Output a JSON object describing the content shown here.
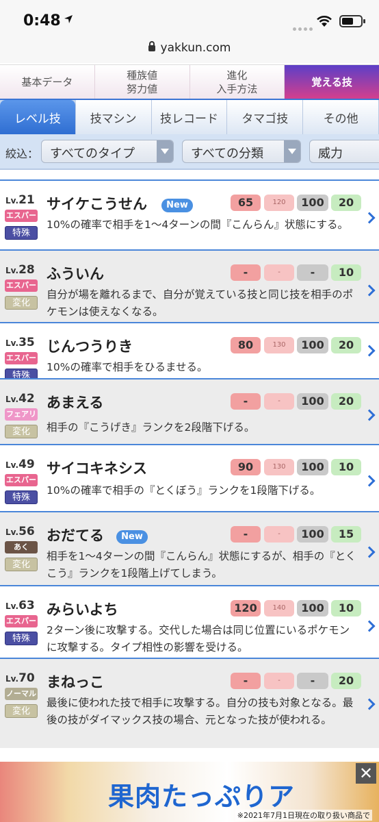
{
  "status_bar": {
    "time": "0:48",
    "domain": "yakkun.com"
  },
  "top_tabs": [
    "基本データ",
    "種族値\n努力値",
    "進化\n入手方法",
    "覚える技"
  ],
  "sub_tabs": [
    "レベル技",
    "技マシン",
    "技レコード",
    "タマゴ技",
    "その他"
  ],
  "filter": {
    "label": "絞込：",
    "type_select": "すべてのタイプ",
    "class_select": "すべての分類",
    "sort_select": "威力"
  },
  "moves": [
    {
      "level_prefix": "Lv.",
      "level": "21",
      "type": "エスパー",
      "type_color": "#e8658f",
      "category": "特殊",
      "name": "サイケこうせん",
      "new_label": "New",
      "power": "65",
      "power2": "120",
      "accuracy": "100",
      "pp": "20",
      "desc": "10%の確率で相手を1〜4ターンの間『こんらん』状態にする。"
    },
    {
      "level_prefix": "Lv.",
      "level": "28",
      "type": "エスパー",
      "type_color": "#e8658f",
      "category": "変化",
      "name": "ふういん",
      "new_label": "",
      "power": "-",
      "power2": "-",
      "accuracy": "-",
      "pp": "10",
      "desc": "自分が場を離れるまで、自分が覚えている技と同じ技を相手のポケモンは使えなくなる。"
    },
    {
      "level_prefix": "Lv.",
      "level": "35",
      "type": "エスパー",
      "type_color": "#e8658f",
      "category": "特殊",
      "name": "じんつうりき",
      "new_label": "",
      "power": "80",
      "power2": "130",
      "accuracy": "100",
      "pp": "20",
      "desc": "10%の確率で相手をひるませる。"
    },
    {
      "level_prefix": "Lv.",
      "level": "42",
      "type": "フェアリー",
      "type_color": "#ef96c8",
      "category": "変化",
      "name": "あまえる",
      "new_label": "",
      "power": "-",
      "power2": "-",
      "accuracy": "100",
      "pp": "20",
      "desc": "相手の『こうげき』ランクを2段階下げる。"
    },
    {
      "level_prefix": "Lv.",
      "level": "49",
      "type": "エスパー",
      "type_color": "#e8658f",
      "category": "特殊",
      "name": "サイコキネシス",
      "new_label": "",
      "power": "90",
      "power2": "130",
      "accuracy": "100",
      "pp": "10",
      "desc": "10%の確率で相手の『とくぼう』ランクを1段階下げる。"
    },
    {
      "level_prefix": "Lv.",
      "level": "56",
      "type": "あく",
      "type_color": "#6b5446",
      "category": "変化",
      "name": "おだてる",
      "new_label": "New",
      "power": "-",
      "power2": "-",
      "accuracy": "100",
      "pp": "15",
      "desc": "相手を1〜4ターンの間『こんらん』状態にするが、相手の『とくこう』ランクを1段階上げてしまう。"
    },
    {
      "level_prefix": "Lv.",
      "level": "63",
      "type": "エスパー",
      "type_color": "#e8658f",
      "category": "特殊",
      "name": "みらいよち",
      "new_label": "",
      "power": "120",
      "power2": "140",
      "accuracy": "100",
      "pp": "10",
      "desc": "2ターン後に攻撃する。交代した場合は同じ位置にいるポケモンに攻撃する。タイプ相性の影響を受ける。"
    },
    {
      "level_prefix": "Lv.",
      "level": "70",
      "type": "ノーマル",
      "type_color": "#b2ad93",
      "category": "変化",
      "name": "まねっこ",
      "new_label": "",
      "power": "-",
      "power2": "-",
      "accuracy": "-",
      "pp": "20",
      "desc": "最後に使われた技で相手に攻撃する。自分の技も対象となる。最後の技がダイマックス技の場合、元となった技が使われる。"
    }
  ],
  "ad": {
    "headline": "果肉たっぷりア",
    "note": "※2021年7月1日現在の取り扱い商品で",
    "close": "✕"
  }
}
